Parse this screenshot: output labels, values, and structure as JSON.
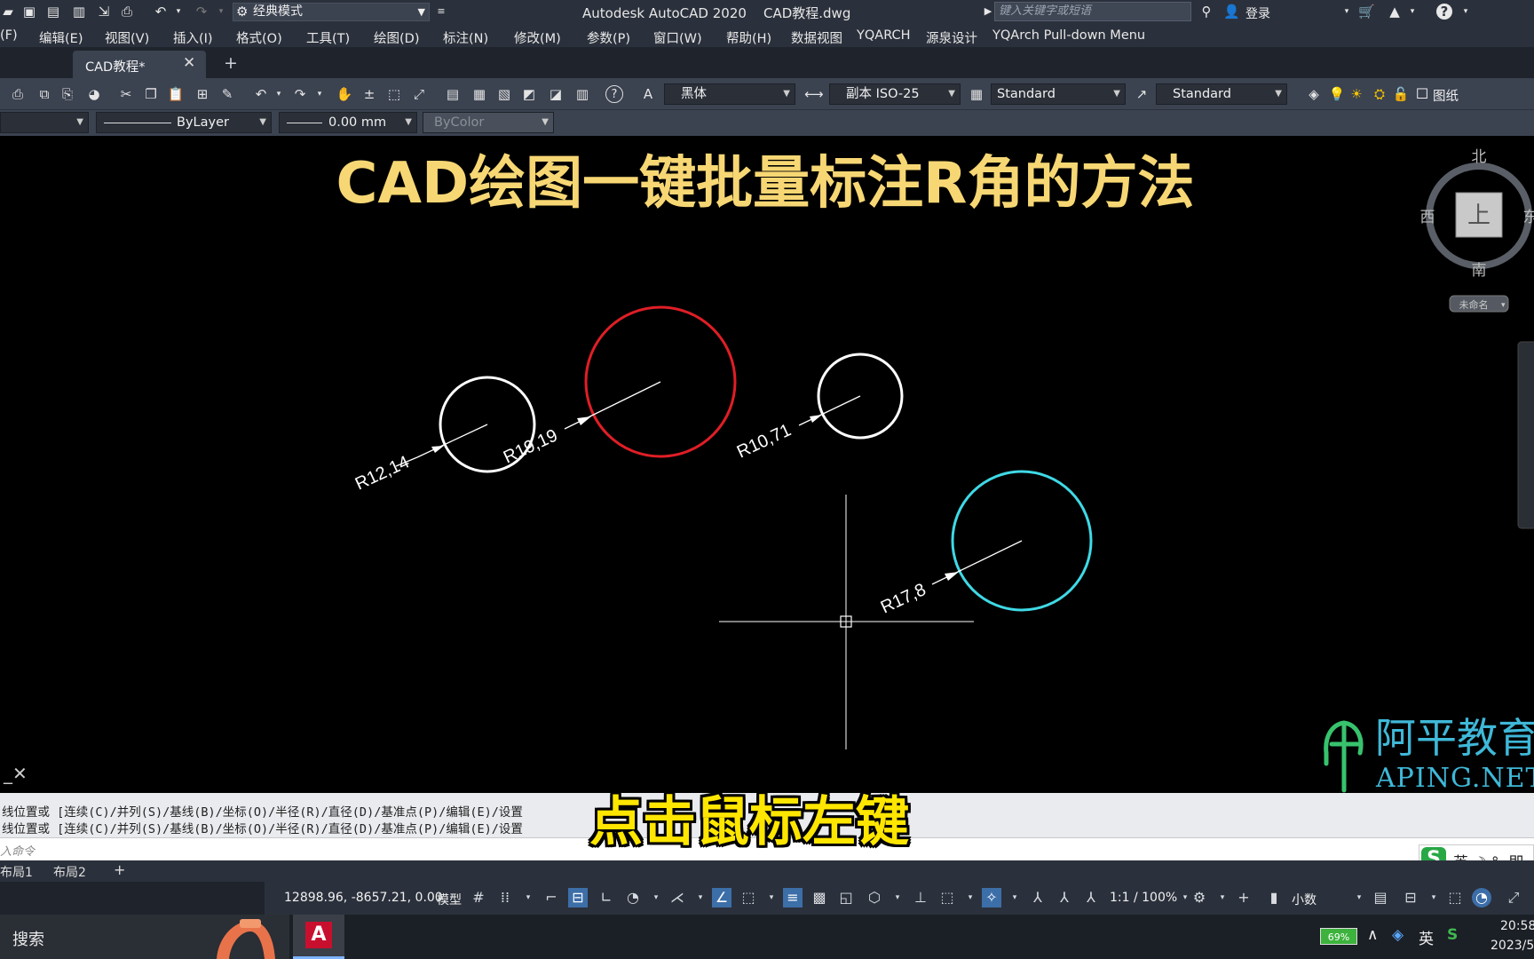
{
  "titlebar": {
    "workspace": "经典模式",
    "app_title": "Autodesk AutoCAD 2020    CAD教程.dwg",
    "search_placeholder": "键入关键字或短语",
    "login": "登录"
  },
  "menubar": {
    "items": [
      "(F)",
      "编辑(E)",
      "视图(V)",
      "插入(I)",
      "格式(O)",
      "工具(T)",
      "绘图(D)",
      "标注(N)",
      "修改(M)",
      "参数(P)",
      "窗口(W)",
      "帮助(H)",
      "数据视图",
      "YQARCH",
      "源泉设计",
      "YQArch Pull-down Menu"
    ]
  },
  "tabs": {
    "document": "CAD教程*"
  },
  "toolbar": {
    "text_style": "黑体",
    "dim_style": "副本 ISO-25",
    "table_style": "Standard",
    "multileader_style": "Standard",
    "layer_name": "图纸",
    "linetype": "ByLayer",
    "lineweight": "0.00 mm",
    "plotstyle": "ByColor"
  },
  "drawing": {
    "title": "CAD绘图一键批量标注R角的方法",
    "colors": {
      "title": "#f7d774",
      "white": "#ffffff",
      "red": "#e01e26",
      "cyan": "#3fd9e6"
    },
    "dimensions": [
      "R12,14",
      "R19,19",
      "R10,71",
      "R17,8"
    ],
    "viewcube": {
      "north": "北",
      "south": "南",
      "west": "西",
      "east": "东",
      "face": "上",
      "ucs": "未命名"
    }
  },
  "command": {
    "history": [
      "线位置或 [连续(C)/并列(S)/基线(B)/坐标(O)/半径(R)/直径(D)/基准点(P)/编辑(E)/设置",
      "线位置或 [连续(C)/并列(S)/基线(B)/坐标(O)/半径(R)/直径(D)/基准点(P)/编辑(E)/设置"
    ],
    "input_placeholder": "入命令"
  },
  "layout_tabs": [
    "布局1",
    "布局2"
  ],
  "statusbar": {
    "coords": "12898.96, -8657.21, 0.00",
    "model": "模型",
    "scale": "1:1 / 100%",
    "units": "小数"
  },
  "overlay": {
    "subtitle": "点击鼠标左键",
    "watermark_cn": "阿平教育",
    "watermark_en": "APING.NET"
  },
  "ime": {
    "label": "英 ☽ °, 即"
  },
  "taskbar": {
    "search": "搜索",
    "battery": "69%",
    "ime": "英",
    "time": "20:58",
    "date": "2023/5"
  }
}
